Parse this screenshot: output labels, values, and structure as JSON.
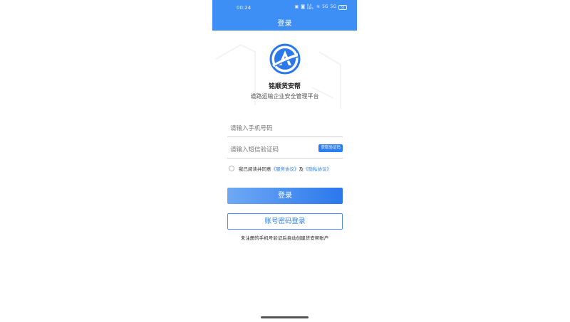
{
  "status_bar": {
    "time": "00:24",
    "network_speed": "0.0 KB/s",
    "signal_1": "5G",
    "signal_2": "5G",
    "battery": "55"
  },
  "header": {
    "title": "登录"
  },
  "brand": {
    "name": "铭顺货安帮",
    "slogan": "道路运输企业安全管理平台"
  },
  "form": {
    "phone_placeholder": "请输入手机号码",
    "sms_placeholder": "请输入短信验证码",
    "get_code_label": "获取验证码"
  },
  "agreement": {
    "prefix": "我已阅读并同意",
    "service_link": "《服务协议》",
    "joiner": "及",
    "privacy_link": "《隐私协议》"
  },
  "buttons": {
    "login": "登录",
    "password_login": "账号密码登录"
  },
  "notice": "未注册的手机号验证后自动创建货安帮账户",
  "colors": {
    "primary": "#3d8ef5",
    "button_gradient_start": "#6fa9f5",
    "button_gradient_end": "#2a78ec"
  }
}
